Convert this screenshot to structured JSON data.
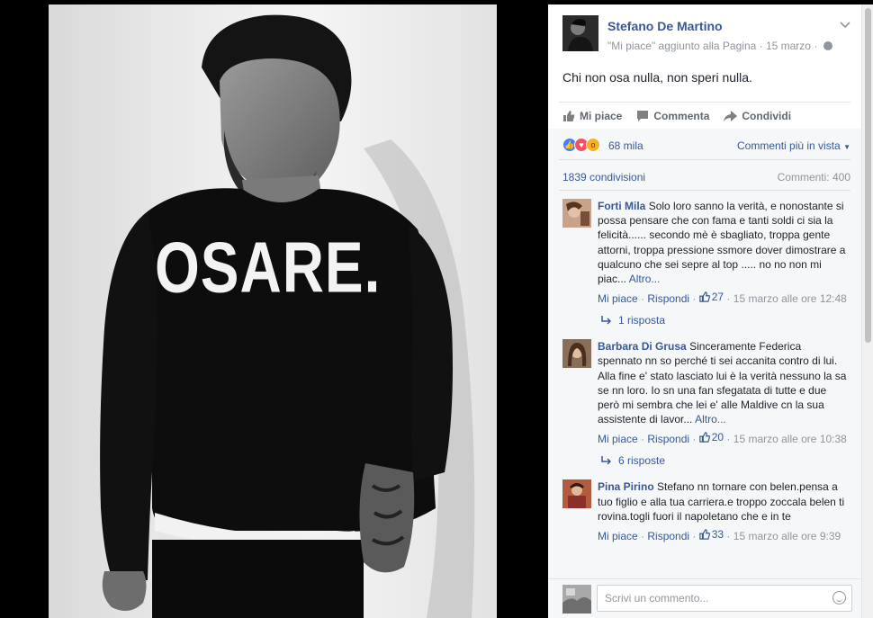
{
  "post": {
    "author": "Stefano De Martino",
    "meta": "\"Mi piace\" aggiunto alla Pagina · 15 marzo ·",
    "text": "Chi non osa nulla, non speri nulla.",
    "photo_text": "OSARE."
  },
  "actions": {
    "like": "Mi piace",
    "comment": "Commenta",
    "share": "Condividi"
  },
  "feedback": {
    "reactions_count": "68 mila",
    "sort_label": "Commenti più in vista",
    "shares": "1839 condivisioni",
    "comments_count": "Commenti: 400"
  },
  "comments": [
    {
      "name": "Forti Mila",
      "text": "Solo loro sanno la verità, e nonostante si possa pensare che con fama e tanti soldi ci sia la felicità...... secondo mè è sbagliato, troppa gente attorni, troppa pressione ssmore dover dimostrare a qualcuno che sei sepre al top ..... no no non mi piac...",
      "more": "Altro...",
      "like": "Mi piace",
      "reply": "Rispondi",
      "likes": "27",
      "time": "15 marzo alle ore 12:48",
      "replies": "1 risposta"
    },
    {
      "name": "Barbara Di Grusa",
      "text": "Sinceramente Federica spennato nn so perché ti sei accanita contro di lui. Alla fine e' stato lasciato lui è la verità nessuno la sa se nn loro. Io sn una fan sfegatata di tutte e due però mi sembra che lei e' alle Maldive cn la sua assistente di lavor...",
      "more": "Altro...",
      "like": "Mi piace",
      "reply": "Rispondi",
      "likes": "20",
      "time": "15 marzo alle ore 10:38",
      "replies": "6 risposte"
    },
    {
      "name": "Pina Pirino",
      "text": "Stefano nn tornare con belen.pensa a tuo figlio e alla tua carriera.e troppo zoccala belen ti rovina.togli fuori il napoletano che e in te",
      "like": "Mi piace",
      "reply": "Rispondi",
      "likes": "33",
      "time": "15 marzo alle ore 9:39"
    }
  ],
  "composer": {
    "placeholder": "Scrivi un commento..."
  },
  "colors": {
    "link": "#365899",
    "muted": "#90949c",
    "panel_bg": "#f6f7f9"
  }
}
